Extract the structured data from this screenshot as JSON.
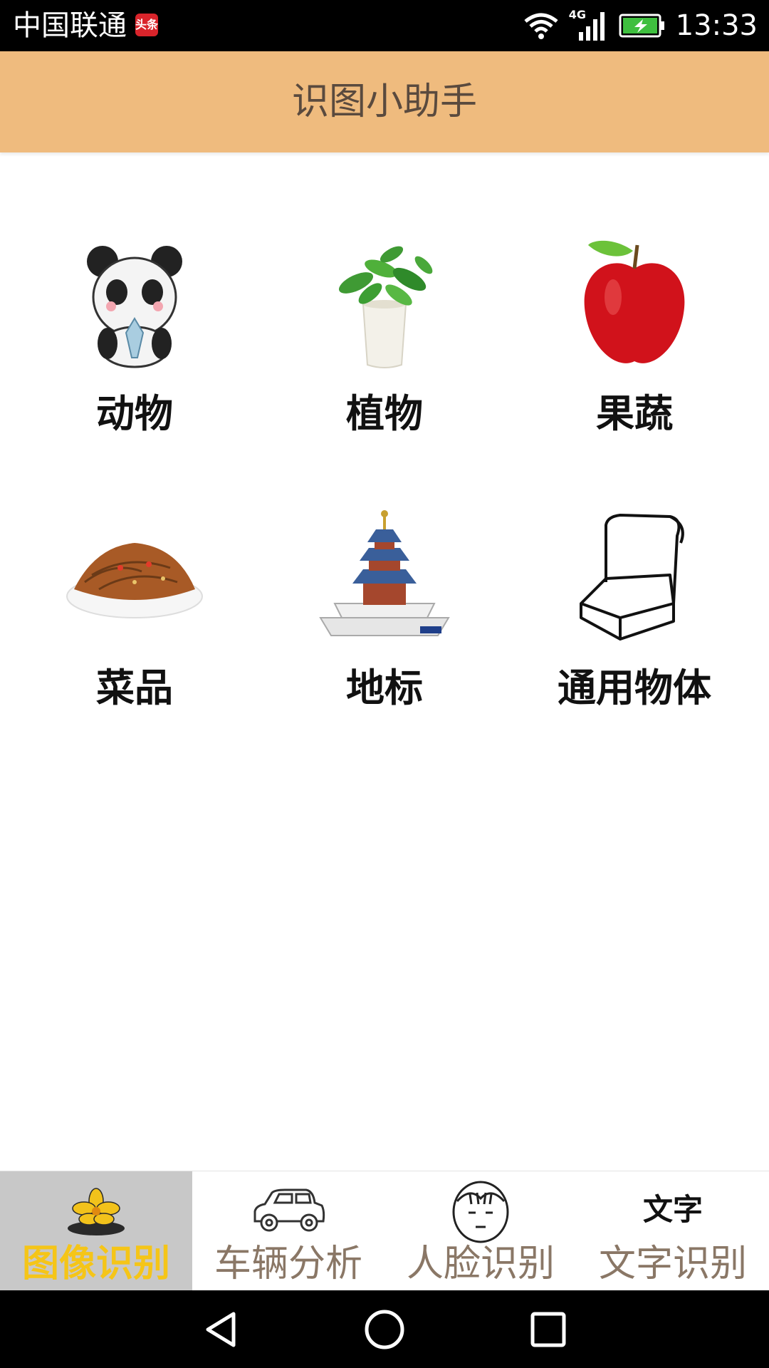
{
  "status_bar": {
    "carrier": "中国联通",
    "news_badge": "头条",
    "network": "4G",
    "time": "13:33"
  },
  "header": {
    "title": "识图小助手"
  },
  "categories": [
    {
      "label": "动物",
      "icon": "panda-icon"
    },
    {
      "label": "植物",
      "icon": "potted-plant-icon"
    },
    {
      "label": "果蔬",
      "icon": "apple-icon"
    },
    {
      "label": "菜品",
      "icon": "noodle-dish-icon"
    },
    {
      "label": "地标",
      "icon": "temple-of-heaven-icon"
    },
    {
      "label": "通用物体",
      "icon": "armchair-icon"
    }
  ],
  "bottom_nav": [
    {
      "label": "图像识别",
      "icon": "flower-icon",
      "active": true
    },
    {
      "label": "车辆分析",
      "icon": "car-icon",
      "active": false
    },
    {
      "label": "人脸识别",
      "icon": "face-icon",
      "active": false
    },
    {
      "label": "文字识别",
      "icon_text": "文字",
      "active": false
    }
  ],
  "colors": {
    "header_bg": "#efbb7e",
    "active_tab_bg": "#c8c8c8",
    "active_tab_text": "#f5c518",
    "inactive_tab_text": "#8a7766"
  }
}
